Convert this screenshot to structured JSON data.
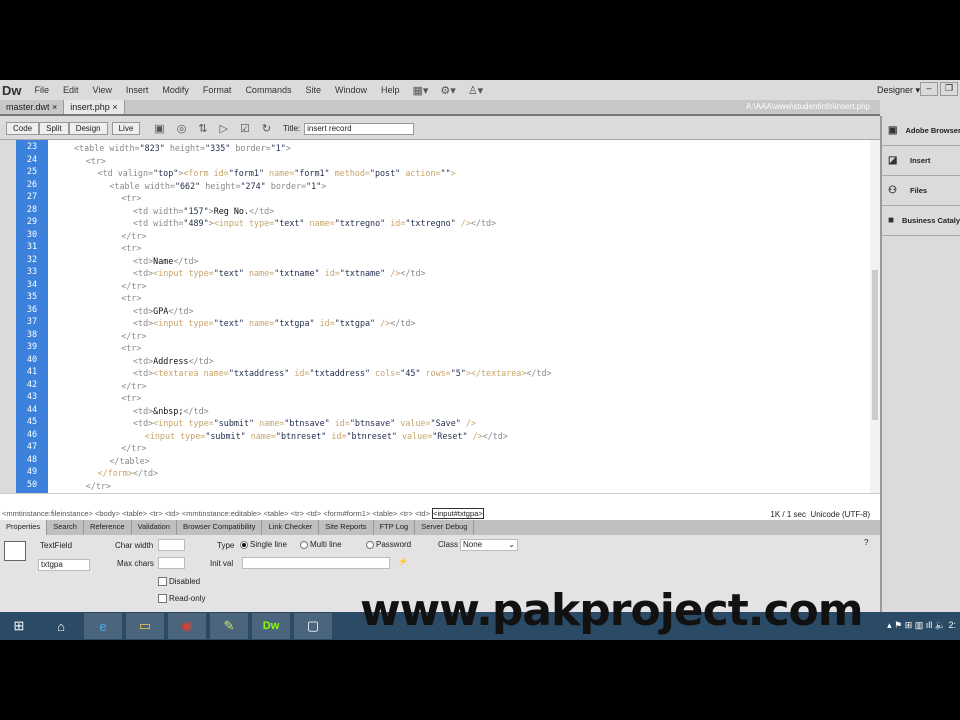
{
  "app": {
    "logo": "Dw",
    "workspace": "Designer ▾"
  },
  "menu": [
    "File",
    "Edit",
    "View",
    "Insert",
    "Modify",
    "Format",
    "Commands",
    "Site",
    "Window",
    "Help"
  ],
  "tabs": [
    {
      "label": "master.dwt ×"
    },
    {
      "label": "insert.php ×"
    }
  ],
  "file_path": "A:\\AAA\\www\\studentinfo\\insert.php",
  "toolbar": {
    "views": [
      "Code",
      "Split",
      "Design",
      "Live"
    ],
    "title_label": "Title:",
    "title_value": "insert record"
  },
  "code": [
    {
      "n": "23",
      "i": 0,
      "s": [
        [
          "g",
          "<table width="
        ],
        [
          "v",
          "\"823\""
        ],
        [
          "g",
          " height="
        ],
        [
          "v",
          "\"335\""
        ],
        [
          "g",
          " border="
        ],
        [
          "v",
          "\"1\""
        ],
        [
          "g",
          ">"
        ]
      ]
    },
    {
      "n": "24",
      "i": 2,
      "s": [
        [
          "g",
          "<tr>"
        ]
      ]
    },
    {
      "n": "25",
      "i": 4,
      "s": [
        [
          "g",
          "<td valign="
        ],
        [
          "v",
          "\"top\""
        ],
        [
          "g",
          ">"
        ],
        [
          "o",
          "<form id="
        ],
        [
          "v",
          "\"form1\""
        ],
        [
          "o",
          " name="
        ],
        [
          "v",
          "\"form1\""
        ],
        [
          "o",
          " method="
        ],
        [
          "v",
          "\"post\""
        ],
        [
          "o",
          " action="
        ],
        [
          "v",
          "\"\""
        ],
        [
          "o",
          ">"
        ]
      ]
    },
    {
      "n": "26",
      "i": 6,
      "s": [
        [
          "g",
          "<table width="
        ],
        [
          "v",
          "\"662\""
        ],
        [
          "g",
          " height="
        ],
        [
          "v",
          "\"274\""
        ],
        [
          "g",
          " border="
        ],
        [
          "v",
          "\"1\""
        ],
        [
          "g",
          ">"
        ]
      ]
    },
    {
      "n": "27",
      "i": 8,
      "s": [
        [
          "g",
          "<tr>"
        ]
      ]
    },
    {
      "n": "28",
      "i": 10,
      "s": [
        [
          "g",
          "<td width="
        ],
        [
          "v",
          "\"157\""
        ],
        [
          "g",
          ">"
        ],
        [
          "x",
          "Reg No."
        ],
        [
          "g",
          "</td>"
        ]
      ]
    },
    {
      "n": "29",
      "i": 10,
      "s": [
        [
          "g",
          "<td width="
        ],
        [
          "v",
          "\"489\""
        ],
        [
          "g",
          ">"
        ],
        [
          "o",
          "<input type="
        ],
        [
          "v",
          "\"text\""
        ],
        [
          "o",
          " name="
        ],
        [
          "v",
          "\"txtregno\""
        ],
        [
          "o",
          " id="
        ],
        [
          "v",
          "\"txtregno\""
        ],
        [
          "o",
          " />"
        ],
        [
          "g",
          "</td>"
        ]
      ]
    },
    {
      "n": "30",
      "i": 8,
      "s": [
        [
          "g",
          "</tr>"
        ]
      ]
    },
    {
      "n": "31",
      "i": 8,
      "s": [
        [
          "g",
          "<tr>"
        ]
      ]
    },
    {
      "n": "32",
      "i": 10,
      "s": [
        [
          "g",
          "<td>"
        ],
        [
          "x",
          "Name"
        ],
        [
          "g",
          "</td>"
        ]
      ]
    },
    {
      "n": "33",
      "i": 10,
      "s": [
        [
          "g",
          "<td>"
        ],
        [
          "o",
          "<input type="
        ],
        [
          "v",
          "\"text\""
        ],
        [
          "o",
          " name="
        ],
        [
          "v",
          "\"txtname\""
        ],
        [
          "o",
          " id="
        ],
        [
          "v",
          "\"txtname\""
        ],
        [
          "o",
          " />"
        ],
        [
          "g",
          "</td>"
        ]
      ]
    },
    {
      "n": "34",
      "i": 8,
      "s": [
        [
          "g",
          "</tr>"
        ]
      ]
    },
    {
      "n": "35",
      "i": 8,
      "s": [
        [
          "g",
          "<tr>"
        ]
      ]
    },
    {
      "n": "36",
      "i": 10,
      "s": [
        [
          "g",
          "<td>"
        ],
        [
          "x",
          "GPA"
        ],
        [
          "g",
          "</td>"
        ]
      ]
    },
    {
      "n": "37",
      "i": 10,
      "s": [
        [
          "g",
          "<td>"
        ],
        [
          "o",
          "<input type="
        ],
        [
          "v",
          "\"text\""
        ],
        [
          "o",
          " name="
        ],
        [
          "v",
          "\"txtgpa\""
        ],
        [
          "o",
          " id="
        ],
        [
          "v",
          "\"txtgpa\""
        ],
        [
          "o",
          " />"
        ],
        [
          "g",
          "</td>"
        ]
      ]
    },
    {
      "n": "38",
      "i": 8,
      "s": [
        [
          "g",
          "</tr>"
        ]
      ]
    },
    {
      "n": "39",
      "i": 8,
      "s": [
        [
          "g",
          "<tr>"
        ]
      ]
    },
    {
      "n": "40",
      "i": 10,
      "s": [
        [
          "g",
          "<td>"
        ],
        [
          "x",
          "Address"
        ],
        [
          "g",
          "</td>"
        ]
      ]
    },
    {
      "n": "41",
      "i": 10,
      "s": [
        [
          "g",
          "<td>"
        ],
        [
          "o",
          "<textarea name="
        ],
        [
          "v",
          "\"txtaddress\""
        ],
        [
          "o",
          " id="
        ],
        [
          "v",
          "\"txtaddress\""
        ],
        [
          "o",
          " cols="
        ],
        [
          "v",
          "\"45\""
        ],
        [
          "o",
          " rows="
        ],
        [
          "v",
          "\"5\""
        ],
        [
          "o",
          "></textarea>"
        ],
        [
          "g",
          "</td>"
        ]
      ]
    },
    {
      "n": "42",
      "i": 8,
      "s": [
        [
          "g",
          "</tr>"
        ]
      ]
    },
    {
      "n": "43",
      "i": 8,
      "s": [
        [
          "g",
          "<tr>"
        ]
      ]
    },
    {
      "n": "44",
      "i": 10,
      "s": [
        [
          "g",
          "<td>"
        ],
        [
          "x",
          "&nbsp;"
        ],
        [
          "g",
          "</td>"
        ]
      ]
    },
    {
      "n": "45",
      "i": 10,
      "s": [
        [
          "g",
          "<td>"
        ],
        [
          "o",
          "<input type="
        ],
        [
          "v",
          "\"submit\""
        ],
        [
          "o",
          " name="
        ],
        [
          "v",
          "\"btnsave\""
        ],
        [
          "o",
          " id="
        ],
        [
          "v",
          "\"btnsave\""
        ],
        [
          "o",
          " value="
        ],
        [
          "v",
          "\"Save\""
        ],
        [
          "o",
          " />"
        ]
      ]
    },
    {
      "n": "46",
      "i": 12,
      "s": [
        [
          "o",
          "<input type="
        ],
        [
          "v",
          "\"submit\""
        ],
        [
          "o",
          " name="
        ],
        [
          "v",
          "\"btnreset\""
        ],
        [
          "o",
          " id="
        ],
        [
          "v",
          "\"btnreset\""
        ],
        [
          "o",
          " value="
        ],
        [
          "v",
          "\"Reset\""
        ],
        [
          "o",
          " />"
        ],
        [
          "g",
          "</td>"
        ]
      ]
    },
    {
      "n": "47",
      "i": 8,
      "s": [
        [
          "g",
          "</tr>"
        ]
      ]
    },
    {
      "n": "48",
      "i": 6,
      "s": [
        [
          "g",
          "</table>"
        ]
      ]
    },
    {
      "n": "49",
      "i": 4,
      "s": [
        [
          "o",
          "</form>"
        ],
        [
          "g",
          "</td>"
        ]
      ]
    },
    {
      "n": "50",
      "i": 2,
      "s": [
        [
          "g",
          "</tr>"
        ]
      ]
    }
  ],
  "tag_selector": {
    "items": [
      "<mmtinstance:fileinstance>",
      "<body>",
      "<table>",
      "<tr>",
      "<td>",
      "<mmtinstance:editable>",
      "<table>",
      "<tr>",
      "<td>",
      "<form#form1>",
      "<table>",
      "<tr>",
      "<td>"
    ],
    "selected": "<input#txtgpa>"
  },
  "status": {
    "download": "1K / 1 sec",
    "encoding": "Unicode (UTF-8)"
  },
  "panel_tabs": [
    "Properties",
    "Search",
    "Reference",
    "Validation",
    "Browser Compatibility",
    "Link Checker",
    "Site Reports",
    "FTP Log",
    "Server Debug"
  ],
  "properties": {
    "element_type": "TextField",
    "name_value": "txtgpa",
    "char_width_label": "Char width",
    "max_chars_label": "Max chars",
    "type_label": "Type",
    "type_options": [
      "Single line",
      "Multi line",
      "Password"
    ],
    "type_selected": "Single line",
    "init_val_label": "Init val",
    "class_label": "Class",
    "class_value": "None",
    "disabled_label": "Disabled",
    "readonly_label": "Read-only"
  },
  "right_panel": [
    "Adobe BrowserLab",
    "Insert",
    "Files",
    "Business Catalyst"
  ],
  "watermark": "www.pakproject.com",
  "tray": {
    "time": "2:"
  }
}
